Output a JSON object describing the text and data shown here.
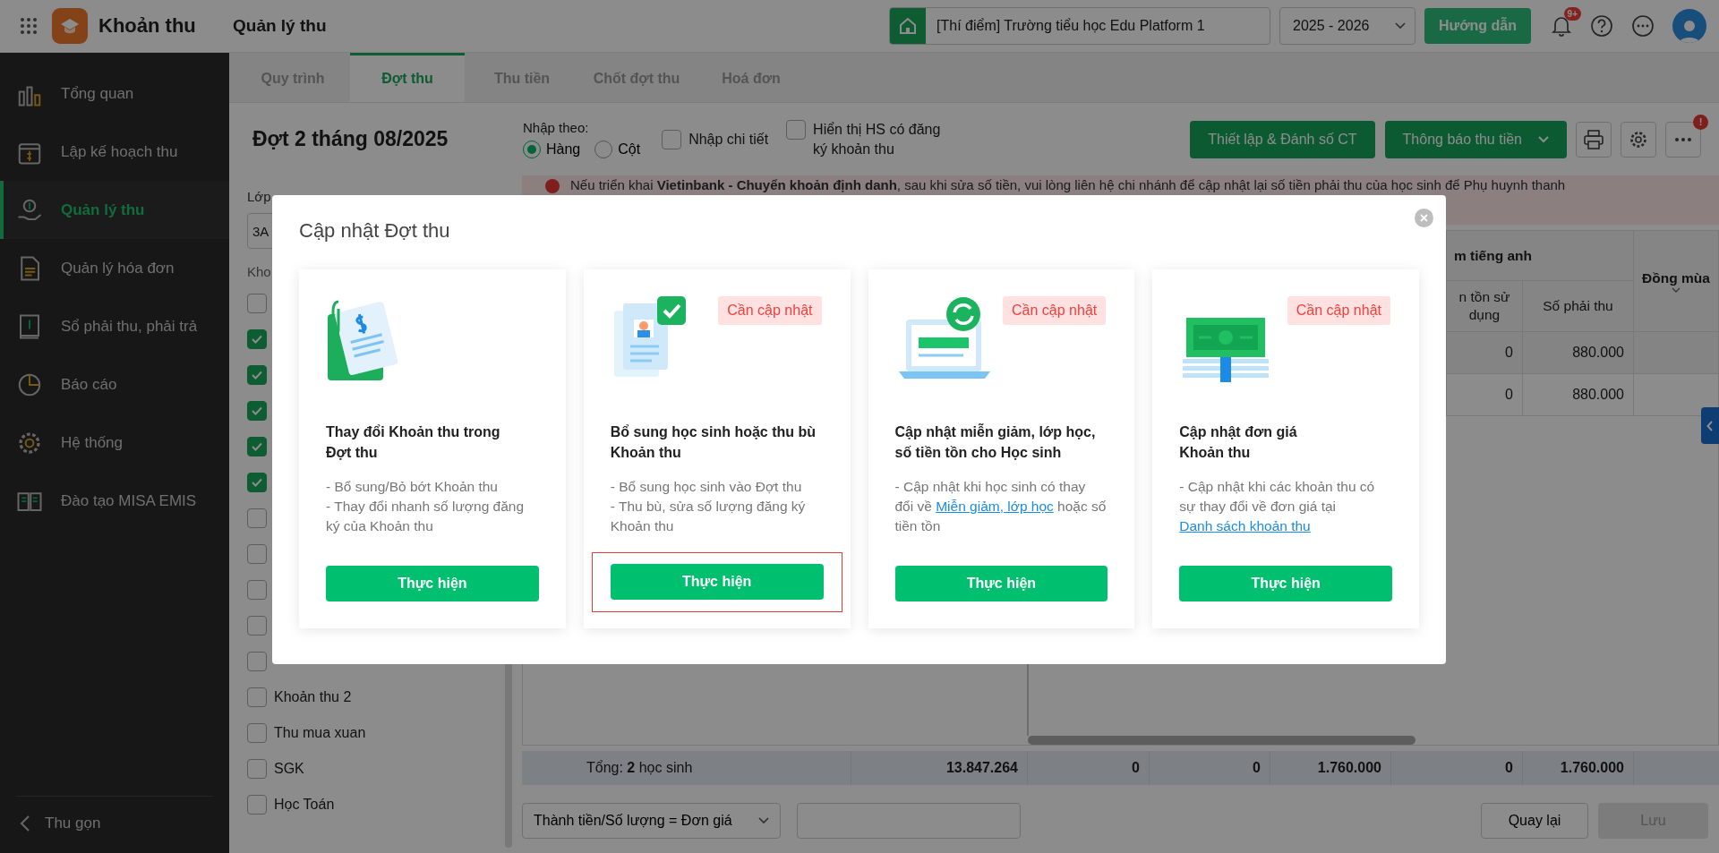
{
  "app": {
    "title": "Khoản thu",
    "page_title": "Quản lý thu"
  },
  "topbar": {
    "school": "[Thí điểm] Trường tiểu học Edu Platform 1",
    "year": "2025 - 2026",
    "guide_button": "Hướng dẫn",
    "notifications_badge": "9+"
  },
  "sidebar": {
    "items": [
      {
        "label": "Tổng quan",
        "kind": "chart",
        "selected": false
      },
      {
        "label": "Lập kế hoạch thu",
        "kind": "calendar",
        "selected": false
      },
      {
        "label": "Quản lý thu",
        "kind": "hand",
        "selected": true
      },
      {
        "label": "Quản lý hóa đơn",
        "kind": "document",
        "selected": false
      },
      {
        "label": "Sổ phải thu, phải trả",
        "kind": "book",
        "selected": false
      },
      {
        "label": "Báo cáo",
        "kind": "pie",
        "selected": false
      },
      {
        "label": "Hệ thống",
        "kind": "gear",
        "selected": false
      },
      {
        "label": "Đào tạo MISA EMIS",
        "kind": "openbook",
        "selected": false
      }
    ],
    "collapse": "Thu gọn"
  },
  "tabs": [
    {
      "label": "Quy trình",
      "selected": false
    },
    {
      "label": "Đợt thu",
      "selected": true
    },
    {
      "label": "Thu tiền",
      "selected": false
    },
    {
      "label": "Chốt đợt thu",
      "selected": false
    },
    {
      "label": "Hoá đơn",
      "selected": false
    }
  ],
  "header": {
    "title": "Đợt 2 tháng 08/2025",
    "input_by_label": "Nhập theo:",
    "input_by": [
      {
        "label": "Hàng",
        "selected": true
      },
      {
        "label": "Cột",
        "selected": false
      }
    ],
    "options": [
      {
        "label": "Nhập chi tiết",
        "checked": false
      },
      {
        "label": "Hiển thị HS có đăng ký khoản thu",
        "checked": false
      }
    ],
    "setup_button": "Thiết lập & Đánh số CT",
    "notify_button": "Thông báo thu tiền",
    "more_badge": "!"
  },
  "filter": {
    "class_label": "Lớp",
    "class_value": "3A",
    "items_label": "Kho",
    "items": [
      {
        "checked": false
      },
      {
        "checked": true
      },
      {
        "checked": true
      },
      {
        "checked": true
      },
      {
        "checked": true
      },
      {
        "checked": true
      },
      {
        "checked": false
      },
      {
        "checked": false
      },
      {
        "checked": false
      },
      {
        "checked": false
      },
      {
        "checked": false
      },
      {
        "label": "Khoản thu 2",
        "checked": false
      },
      {
        "label": "Thu mua xuan",
        "checked": false
      },
      {
        "label": "SGK",
        "checked": false
      },
      {
        "label": "Học Toán",
        "checked": false
      }
    ]
  },
  "banner": {
    "text": "Nếu triển khai **Vietinbank - Chuyển khoản định danh**, sau khi sửa số tiền, vui lòng liên hệ chi nhánh để cập nhật lại số tiền phải thu của học sinh để Phụ huynh thanh"
  },
  "table": {
    "group_header": "m tiếng anh",
    "columns": [
      "n tồn sử dụng",
      "Số phải thu"
    ],
    "last_column": "Đồng mùa",
    "rows": [
      {
        "cells": [
          "0",
          "880.000"
        ]
      },
      {
        "cells": [
          "0",
          "880.000"
        ]
      }
    ],
    "totals": {
      "label": "Tổng: **2** học sinh",
      "values": [
        "13.847.264",
        "0",
        "0",
        "1.760.000",
        "0",
        "1.760.000"
      ]
    }
  },
  "footer": {
    "formula": "Thành tiền/Số lượng = Đơn giá",
    "back_button": "Quay lại",
    "save_button": {
      "label": "Lưu",
      "disabled": true
    }
  },
  "dialog": {
    "title": "Cập nhật Đợt thu",
    "cards": [
      {
        "kind": "items",
        "needs_update": false,
        "highlighted": false,
        "title": [
          "Thay đổi Khoản thu trong",
          "Đợt thu"
        ],
        "description": [
          [
            {
              "kind": "text",
              "text": "- Bổ sung/Bỏ bớt Khoản thu"
            }
          ],
          [
            {
              "kind": "text",
              "text": "- Thay đổi nhanh số lượng đăng ký của Khoản thu"
            }
          ]
        ],
        "button": "Thực hiện"
      },
      {
        "kind": "students",
        "needs_update": true,
        "badge": "Cần cập nhật",
        "highlighted": true,
        "title": [
          "Bổ sung học sinh hoặc thu bù",
          "Khoản thu"
        ],
        "description": [
          [
            {
              "kind": "text",
              "text": "- Bổ sung học sinh vào Đợt thu"
            }
          ],
          [
            {
              "kind": "text",
              "text": "- Thu bù, sửa số lượng đăng ký Khoản thu"
            }
          ]
        ],
        "button": "Thực hiện"
      },
      {
        "kind": "laptop",
        "needs_update": true,
        "badge": "Cần cập nhật",
        "highlighted": false,
        "title": [
          "Cập nhật miễn giảm, lớp học,",
          "số tiền tồn cho Học sinh"
        ],
        "description": [
          [
            {
              "kind": "text",
              "text": "- Cập nhật khi học sinh có thay đổi về "
            },
            {
              "kind": "link",
              "text": "Miễn giảm, lớp học"
            },
            {
              "kind": "text",
              "text": " hoặc số tiền tồn"
            }
          ]
        ],
        "button": "Thực hiện"
      },
      {
        "kind": "money",
        "needs_update": true,
        "badge": "Cần cập nhật",
        "highlighted": false,
        "title": [
          "Cập nhật đơn giá",
          "Khoản thu"
        ],
        "description": [
          [
            {
              "kind": "text",
              "text": "- Cập nhật khi các khoản thu có sự thay đổi về đơn giá tại "
            },
            {
              "kind": "link",
              "text": "Danh sách khoản thu"
            }
          ]
        ],
        "button": "Thực hiện"
      }
    ]
  }
}
